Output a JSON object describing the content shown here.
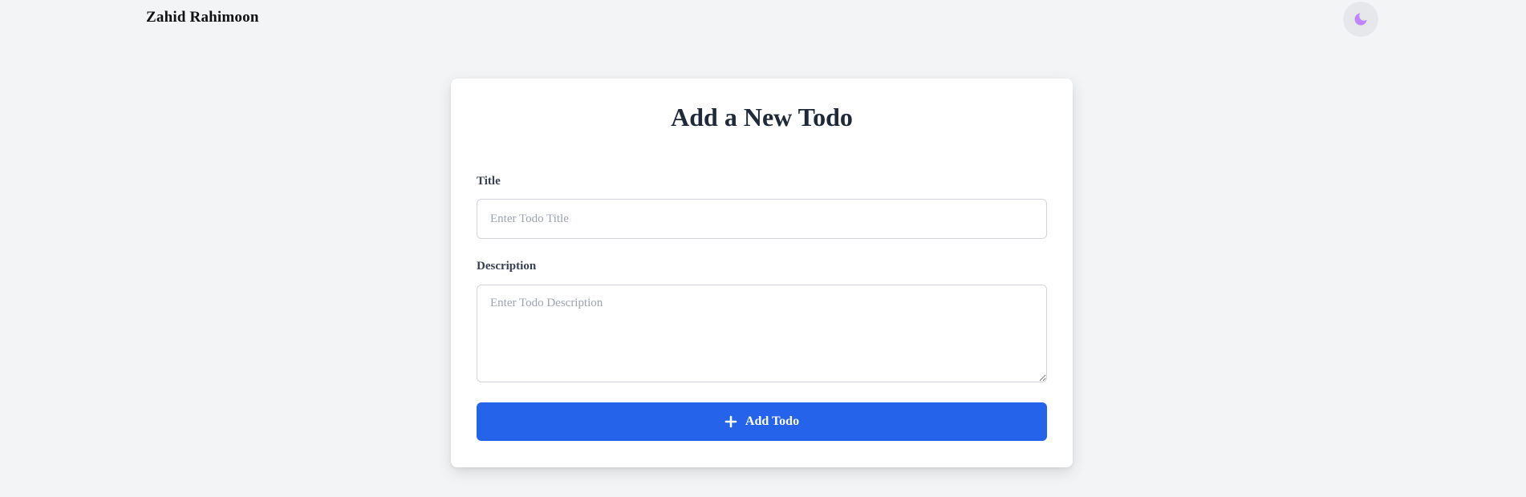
{
  "header": {
    "brand": "Zahid Rahimoon",
    "theme_toggle_icon": "moon-icon"
  },
  "form": {
    "heading": "Add a New Todo",
    "title_label": "Title",
    "title_placeholder": "Enter Todo Title",
    "title_value": "",
    "description_label": "Description",
    "description_placeholder": "Enter Todo Description",
    "description_value": "",
    "submit_label": "Add Todo",
    "submit_icon": "plus-icon"
  },
  "colors": {
    "page_background": "#f3f4f6",
    "card_background": "#ffffff",
    "primary_button": "#2563eb",
    "moon_icon": "#c084fc"
  }
}
